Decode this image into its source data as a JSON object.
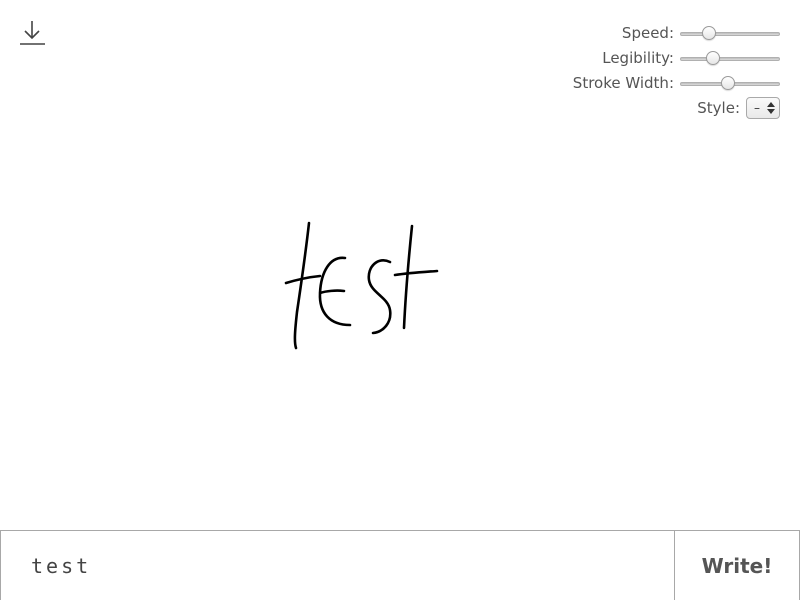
{
  "toolbar": {
    "download_icon": "download-icon"
  },
  "controls": {
    "speed": {
      "label": "Speed:",
      "value": 0.25
    },
    "legibility": {
      "label": "Legibility:",
      "value": 0.3
    },
    "stroke_width": {
      "label": "Stroke Width:",
      "value": 0.48
    },
    "style": {
      "label": "Style:",
      "value": "–"
    }
  },
  "canvas": {
    "rendered_text": "test",
    "stroke_color": "#000000"
  },
  "input": {
    "value": "test",
    "write_label": "Write!"
  }
}
